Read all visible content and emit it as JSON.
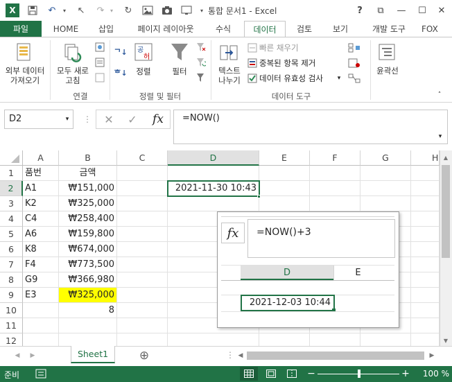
{
  "window": {
    "title": "통합 문서1 - Excel",
    "help": "?",
    "restore": "⧉",
    "minimize": "—",
    "maximize": "☐",
    "close": "✕"
  },
  "tabs": {
    "file": "파일",
    "home": "HOME",
    "insert": "삽입",
    "layout": "페이지 레이아웃",
    "formulas": "수식",
    "data": "데이터",
    "review": "검토",
    "view": "보기",
    "developer": "개발 도구",
    "fox": "FOX"
  },
  "ribbon": {
    "external": [
      "외부 데이터",
      "가져오기"
    ],
    "refresh": [
      "모두 새로",
      "고침"
    ],
    "group_connections": "연결",
    "sort": "정렬",
    "filter": "필터",
    "group_sort": "정렬 및 필터",
    "text_to_col": [
      "텍스트",
      "나누기"
    ],
    "flash_fill": "빠른 채우기",
    "remove_dup": "중복된 항목 제거",
    "validation": "데이터 유효성 검사",
    "group_tools": "데이터 도구",
    "outline": "윤곽선"
  },
  "formula_bar": {
    "name_box": "D2",
    "formula": "=NOW()",
    "fx": "fx"
  },
  "columns": [
    "A",
    "B",
    "C",
    "D",
    "E",
    "F",
    "G",
    "H"
  ],
  "rows": [
    {
      "n": "1",
      "a": "품번",
      "b": "금액"
    },
    {
      "n": "2",
      "a": "A1",
      "b": "₩151,000",
      "d": "2021-11-30 10:43"
    },
    {
      "n": "3",
      "a": "K2",
      "b": "₩325,000"
    },
    {
      "n": "4",
      "a": "C4",
      "b": "₩258,400"
    },
    {
      "n": "5",
      "a": "A6",
      "b": "₩159,800"
    },
    {
      "n": "6",
      "a": "K8",
      "b": "₩674,000"
    },
    {
      "n": "7",
      "a": "F4",
      "b": "₩773,500"
    },
    {
      "n": "8",
      "a": "G9",
      "b": "₩366,980"
    },
    {
      "n": "9",
      "a": "E3",
      "b": "₩325,000"
    },
    {
      "n": "10",
      "a": "",
      "b": "8"
    },
    {
      "n": "11",
      "a": "",
      "b": ""
    },
    {
      "n": "12",
      "a": "",
      "b": ""
    }
  ],
  "popup": {
    "fx": "fx",
    "formula": "=NOW()+3",
    "col_d": "D",
    "col_e": "E",
    "value": "2021-12-03 10:44"
  },
  "sheet": {
    "tab": "Sheet1",
    "add": "⊕"
  },
  "status": {
    "ready": "준비",
    "zoom": "100 %"
  },
  "colors": {
    "excel_green": "#217346",
    "highlight": "#ffff00"
  }
}
